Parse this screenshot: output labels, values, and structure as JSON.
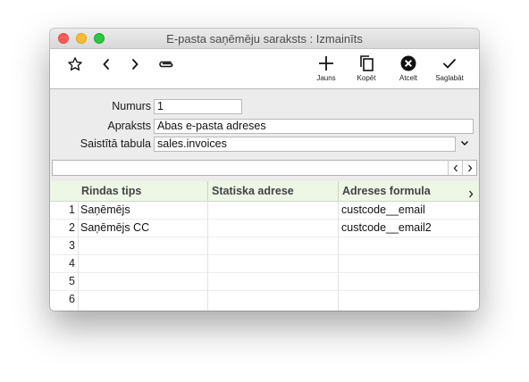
{
  "window": {
    "title": "E-pasta saņēmēju saraksts : Izmainīts"
  },
  "toolbar": {
    "new_label": "Jauns",
    "copy_label": "Kopēt",
    "cancel_label": "Atcelt",
    "save_label": "Saglabāt"
  },
  "form": {
    "number_label": "Numurs",
    "number_value": "1",
    "description_label": "Apraksts",
    "description_value": "Abas e-pasta adreses",
    "table_label": "Saistītā tabula",
    "table_value": "sales.invoices"
  },
  "grid": {
    "columns": [
      "Rindas tips",
      "Statiska adrese",
      "Adreses formula"
    ],
    "rows": [
      {
        "num": "1",
        "type": "Saņēmējs",
        "static": "",
        "formula": "custcode__email"
      },
      {
        "num": "2",
        "type": "Saņēmējs CC",
        "static": "",
        "formula": "custcode__email2"
      },
      {
        "num": "3",
        "type": "",
        "static": "",
        "formula": ""
      },
      {
        "num": "4",
        "type": "",
        "static": "",
        "formula": ""
      },
      {
        "num": "5",
        "type": "",
        "static": "",
        "formula": ""
      },
      {
        "num": "6",
        "type": "",
        "static": "",
        "formula": ""
      }
    ]
  },
  "colors": {
    "header_bg": "#eef6e6",
    "close": "#fc5f57",
    "minimize": "#fdbc2e",
    "maximize": "#29c840"
  }
}
